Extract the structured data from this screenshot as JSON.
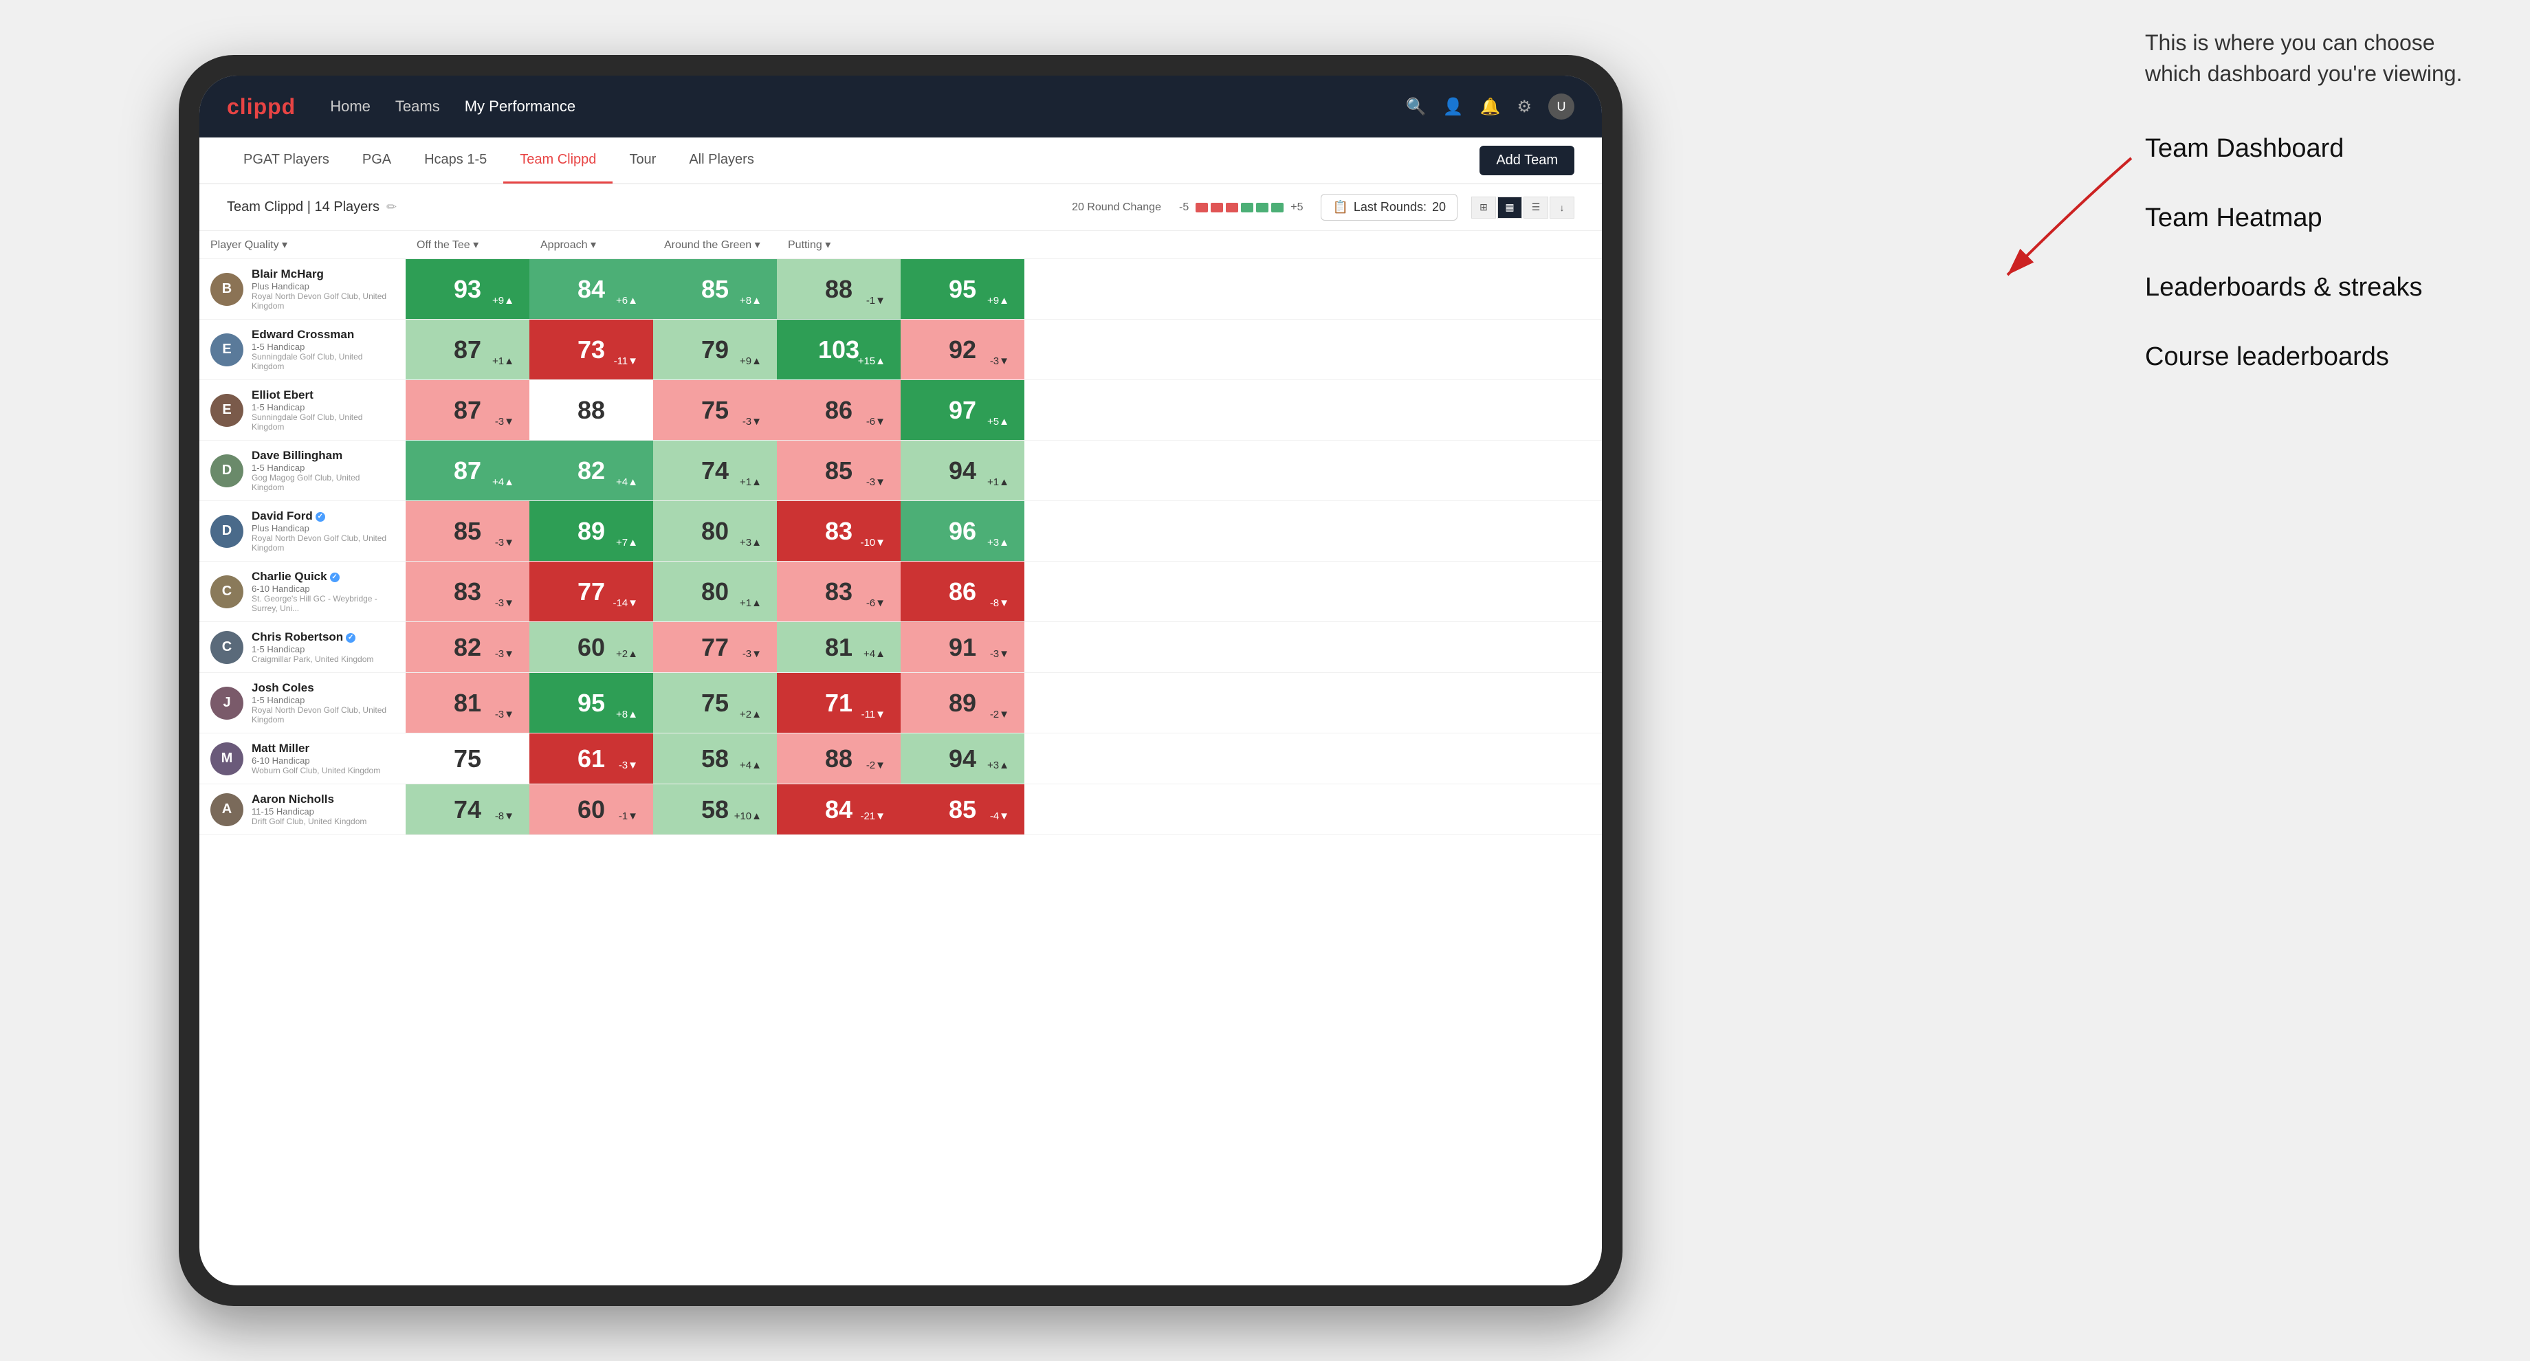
{
  "annotation": {
    "description": "This is where you can choose which dashboard you're viewing.",
    "items": [
      "Team Dashboard",
      "Team Heatmap",
      "Leaderboards & streaks",
      "Course leaderboards"
    ]
  },
  "nav": {
    "logo": "clippd",
    "links": [
      "Home",
      "Teams",
      "My Performance"
    ],
    "active_link": "My Performance"
  },
  "sub_nav": {
    "links": [
      "PGAT Players",
      "PGA",
      "Hcaps 1-5",
      "Team Clippd",
      "Tour",
      "All Players"
    ],
    "active": "Team Clippd",
    "add_team_label": "Add Team"
  },
  "team_header": {
    "name": "Team Clippd | 14 Players",
    "round_change_label": "20 Round Change",
    "neg_label": "-5",
    "pos_label": "+5",
    "last_rounds_label": "Last Rounds:",
    "last_rounds_value": "20"
  },
  "columns": {
    "player_quality": "Player Quality ▾",
    "off_tee": "Off the Tee ▾",
    "approach": "Approach ▾",
    "around_green": "Around the Green ▾",
    "putting": "Putting ▾"
  },
  "players": [
    {
      "name": "Blair McHarg",
      "handicap": "Plus Handicap",
      "club": "Royal North Devon Golf Club, United Kingdom",
      "avatar_color": "#8B7355",
      "initials": "B",
      "scores": {
        "player_quality": {
          "value": 93,
          "change": "+9",
          "dir": "up",
          "color": "green-dark"
        },
        "off_tee": {
          "value": 84,
          "change": "+6",
          "dir": "up",
          "color": "green-med"
        },
        "approach": {
          "value": 85,
          "change": "+8",
          "dir": "up",
          "color": "green-med"
        },
        "around_green": {
          "value": 88,
          "change": "-1",
          "dir": "down",
          "color": "green-light"
        },
        "putting": {
          "value": 95,
          "change": "+9",
          "dir": "up",
          "color": "green-dark"
        }
      }
    },
    {
      "name": "Edward Crossman",
      "handicap": "1-5 Handicap",
      "club": "Sunningdale Golf Club, United Kingdom",
      "avatar_color": "#5a7a9a",
      "initials": "E",
      "scores": {
        "player_quality": {
          "value": 87,
          "change": "+1",
          "dir": "up",
          "color": "green-light"
        },
        "off_tee": {
          "value": 73,
          "change": "-11",
          "dir": "down",
          "color": "red-dark"
        },
        "approach": {
          "value": 79,
          "change": "+9",
          "dir": "up",
          "color": "green-light"
        },
        "around_green": {
          "value": 103,
          "change": "+15",
          "dir": "up",
          "color": "green-dark"
        },
        "putting": {
          "value": 92,
          "change": "-3",
          "dir": "down",
          "color": "red-light"
        }
      }
    },
    {
      "name": "Elliot Ebert",
      "handicap": "1-5 Handicap",
      "club": "Sunningdale Golf Club, United Kingdom",
      "avatar_color": "#7a5a4a",
      "initials": "E",
      "scores": {
        "player_quality": {
          "value": 87,
          "change": "-3",
          "dir": "down",
          "color": "red-light"
        },
        "off_tee": {
          "value": 88,
          "change": "",
          "dir": "",
          "color": "white-cell"
        },
        "approach": {
          "value": 75,
          "change": "-3",
          "dir": "down",
          "color": "red-light"
        },
        "around_green": {
          "value": 86,
          "change": "-6",
          "dir": "down",
          "color": "red-light"
        },
        "putting": {
          "value": 97,
          "change": "+5",
          "dir": "up",
          "color": "green-dark"
        }
      }
    },
    {
      "name": "Dave Billingham",
      "handicap": "1-5 Handicap",
      "club": "Gog Magog Golf Club, United Kingdom",
      "avatar_color": "#6a8a6a",
      "initials": "D",
      "scores": {
        "player_quality": {
          "value": 87,
          "change": "+4",
          "dir": "up",
          "color": "green-med"
        },
        "off_tee": {
          "value": 82,
          "change": "+4",
          "dir": "up",
          "color": "green-med"
        },
        "approach": {
          "value": 74,
          "change": "+1",
          "dir": "up",
          "color": "green-light"
        },
        "around_green": {
          "value": 85,
          "change": "-3",
          "dir": "down",
          "color": "red-light"
        },
        "putting": {
          "value": 94,
          "change": "+1",
          "dir": "up",
          "color": "green-light"
        }
      }
    },
    {
      "name": "David Ford",
      "handicap": "Plus Handicap",
      "club": "Royal North Devon Golf Club, United Kingdom",
      "avatar_color": "#4a6a8a",
      "initials": "D",
      "verified": true,
      "scores": {
        "player_quality": {
          "value": 85,
          "change": "-3",
          "dir": "down",
          "color": "red-light"
        },
        "off_tee": {
          "value": 89,
          "change": "+7",
          "dir": "up",
          "color": "green-dark"
        },
        "approach": {
          "value": 80,
          "change": "+3",
          "dir": "up",
          "color": "green-light"
        },
        "around_green": {
          "value": 83,
          "change": "-10",
          "dir": "down",
          "color": "red-dark"
        },
        "putting": {
          "value": 96,
          "change": "+3",
          "dir": "up",
          "color": "green-med"
        }
      }
    },
    {
      "name": "Charlie Quick",
      "handicap": "6-10 Handicap",
      "club": "St. George's Hill GC - Weybridge - Surrey, Uni...",
      "avatar_color": "#8a7a5a",
      "initials": "C",
      "verified": true,
      "scores": {
        "player_quality": {
          "value": 83,
          "change": "-3",
          "dir": "down",
          "color": "red-light"
        },
        "off_tee": {
          "value": 77,
          "change": "-14",
          "dir": "down",
          "color": "red-dark"
        },
        "approach": {
          "value": 80,
          "change": "+1",
          "dir": "up",
          "color": "green-light"
        },
        "around_green": {
          "value": 83,
          "change": "-6",
          "dir": "down",
          "color": "red-light"
        },
        "putting": {
          "value": 86,
          "change": "-8",
          "dir": "down",
          "color": "red-dark"
        }
      }
    },
    {
      "name": "Chris Robertson",
      "handicap": "1-5 Handicap",
      "club": "Craigmillar Park, United Kingdom",
      "avatar_color": "#5a6a7a",
      "initials": "C",
      "verified": true,
      "scores": {
        "player_quality": {
          "value": 82,
          "change": "-3",
          "dir": "down",
          "color": "red-light"
        },
        "off_tee": {
          "value": 60,
          "change": "+2",
          "dir": "up",
          "color": "green-light"
        },
        "approach": {
          "value": 77,
          "change": "-3",
          "dir": "down",
          "color": "red-light"
        },
        "around_green": {
          "value": 81,
          "change": "+4",
          "dir": "up",
          "color": "green-light"
        },
        "putting": {
          "value": 91,
          "change": "-3",
          "dir": "down",
          "color": "red-light"
        }
      }
    },
    {
      "name": "Josh Coles",
      "handicap": "1-5 Handicap",
      "club": "Royal North Devon Golf Club, United Kingdom",
      "avatar_color": "#7a5a6a",
      "initials": "J",
      "scores": {
        "player_quality": {
          "value": 81,
          "change": "-3",
          "dir": "down",
          "color": "red-light"
        },
        "off_tee": {
          "value": 95,
          "change": "+8",
          "dir": "up",
          "color": "green-dark"
        },
        "approach": {
          "value": 75,
          "change": "+2",
          "dir": "up",
          "color": "green-light"
        },
        "around_green": {
          "value": 71,
          "change": "-11",
          "dir": "down",
          "color": "red-dark"
        },
        "putting": {
          "value": 89,
          "change": "-2",
          "dir": "down",
          "color": "red-light"
        }
      }
    },
    {
      "name": "Matt Miller",
      "handicap": "6-10 Handicap",
      "club": "Woburn Golf Club, United Kingdom",
      "avatar_color": "#6a5a7a",
      "initials": "M",
      "scores": {
        "player_quality": {
          "value": 75,
          "change": "",
          "dir": "",
          "color": "white-cell"
        },
        "off_tee": {
          "value": 61,
          "change": "-3",
          "dir": "down",
          "color": "red-dark"
        },
        "approach": {
          "value": 58,
          "change": "+4",
          "dir": "up",
          "color": "green-light"
        },
        "around_green": {
          "value": 88,
          "change": "-2",
          "dir": "down",
          "color": "red-light"
        },
        "putting": {
          "value": 94,
          "change": "+3",
          "dir": "up",
          "color": "green-light"
        }
      }
    },
    {
      "name": "Aaron Nicholls",
      "handicap": "11-15 Handicap",
      "club": "Drift Golf Club, United Kingdom",
      "avatar_color": "#7a6a5a",
      "initials": "A",
      "scores": {
        "player_quality": {
          "value": 74,
          "change": "-8",
          "dir": "down",
          "color": "green-light"
        },
        "off_tee": {
          "value": 60,
          "change": "-1",
          "dir": "down",
          "color": "red-light"
        },
        "approach": {
          "value": 58,
          "change": "+10",
          "dir": "up",
          "color": "green-light"
        },
        "around_green": {
          "value": 84,
          "change": "-21",
          "dir": "down",
          "color": "red-dark"
        },
        "putting": {
          "value": 85,
          "change": "-4",
          "dir": "down",
          "color": "red-dark"
        }
      }
    }
  ]
}
